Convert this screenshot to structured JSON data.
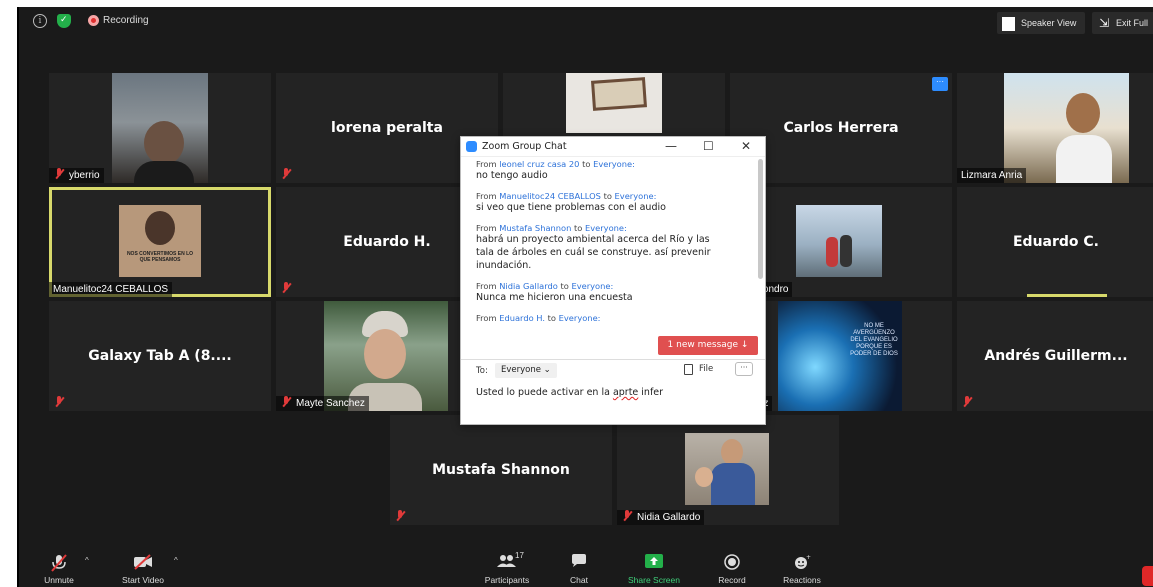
{
  "topbar": {
    "recording_label": "Recording",
    "speaker_view_label": "Speaker View",
    "exit_full_label": "Exit Full"
  },
  "tiles": {
    "yberrio": "yberrio",
    "lorena": "lorena peralta",
    "carlos": "Carlos Herrera",
    "lizmara": "Lizmara Anria",
    "manuelito": "Manuelitoc24 CEBALLOS",
    "manuelito_banner": "NOS CONVERTIMOS EN LO QUE PENSAMOS",
    "eduardo_h": "Eduardo H.",
    "gabriel": "riel Lizondro",
    "eduardo_c": "Eduardo C.",
    "galaxy": "Galaxy Tab A (8....",
    "mayte": "Mayte Sanchez",
    "gonzalez": "onzález",
    "gonzalez_banner": "NO ME AVERGÜENZO DEL EVANGELIO PORQUE ES PODER DE DIOS",
    "andres": "Andrés  Guillerm...",
    "mustafa": "Mustafa Shannon",
    "nidia": "Nidia Gallardo"
  },
  "chat": {
    "title": "Zoom Group Chat",
    "min": "—",
    "max": "☐",
    "close": "✕",
    "messages": [
      {
        "from": "From",
        "sender": "leonel cruz casa  20",
        "to": "to",
        "recipient": "Everyone:",
        "text": "no tengo audio"
      },
      {
        "from": "From",
        "sender": "Manuelitoc24 CEBALLOS",
        "to": "to",
        "recipient": "Everyone:",
        "text": "si veo que tiene problemas con el audio"
      },
      {
        "from": "From",
        "sender": "Mustafa Shannon",
        "to": "to",
        "recipient": "Everyone:",
        "text": "habrá un proyecto ambiental acerca del Río y las tala de árboles en cuál se construye. así prevenir inundación."
      },
      {
        "from": "From",
        "sender": "Nidia Gallardo",
        "to": "to",
        "recipient": "Everyone:",
        "text": "Nunca me hicieron una encuesta"
      },
      {
        "from": "From",
        "sender": "Eduardo H.",
        "to": "to",
        "recipient": "Everyone:",
        "text": ""
      }
    ],
    "new_message": "1 new message ↓",
    "to_label": "To:",
    "to_value": "Everyone ⌄",
    "file_label": "File",
    "more_label": "···",
    "input_before": "Usted lo puede activar en la ",
    "input_typo": "aprte",
    "input_after": " infer"
  },
  "toolbar": {
    "unmute": "Unmute",
    "start_video": "Start Video",
    "participants": "Participants",
    "participants_count": "17",
    "chat": "Chat",
    "share": "Share Screen",
    "record": "Record",
    "reactions": "Reactions"
  },
  "colors": {
    "accent": "#2d8cff",
    "mute_red": "#e03a3a",
    "share_green": "#3fd07a",
    "active_speaker": "#d7d96b"
  }
}
